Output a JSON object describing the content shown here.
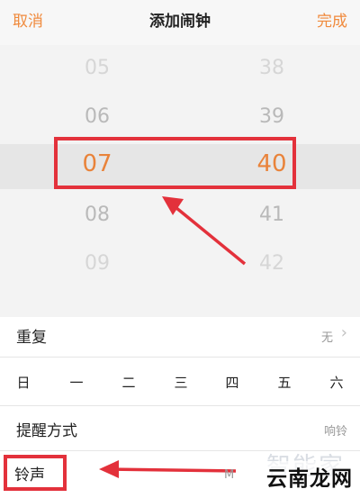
{
  "header": {
    "cancel_label": "取消",
    "title": "添加闹钟",
    "done_label": "完成"
  },
  "time_picker": {
    "hours": [
      "05",
      "06",
      "07",
      "08",
      "09"
    ],
    "minutes": [
      "38",
      "39",
      "40",
      "41",
      "42"
    ],
    "selected_hour": "07",
    "selected_minute": "40"
  },
  "repeat": {
    "label": "重复",
    "value": "无",
    "days": [
      "日",
      "一",
      "二",
      "三",
      "四",
      "五",
      "六"
    ]
  },
  "reminder": {
    "label": "提醒方式",
    "value": "响铃"
  },
  "ringtone": {
    "label": "铃声",
    "value_partial": "M"
  },
  "watermark": {
    "logo_text": "智能家",
    "site_text": "云南龙网"
  },
  "colors": {
    "accent": "#f08a3c",
    "annotation": "#e3313b"
  }
}
